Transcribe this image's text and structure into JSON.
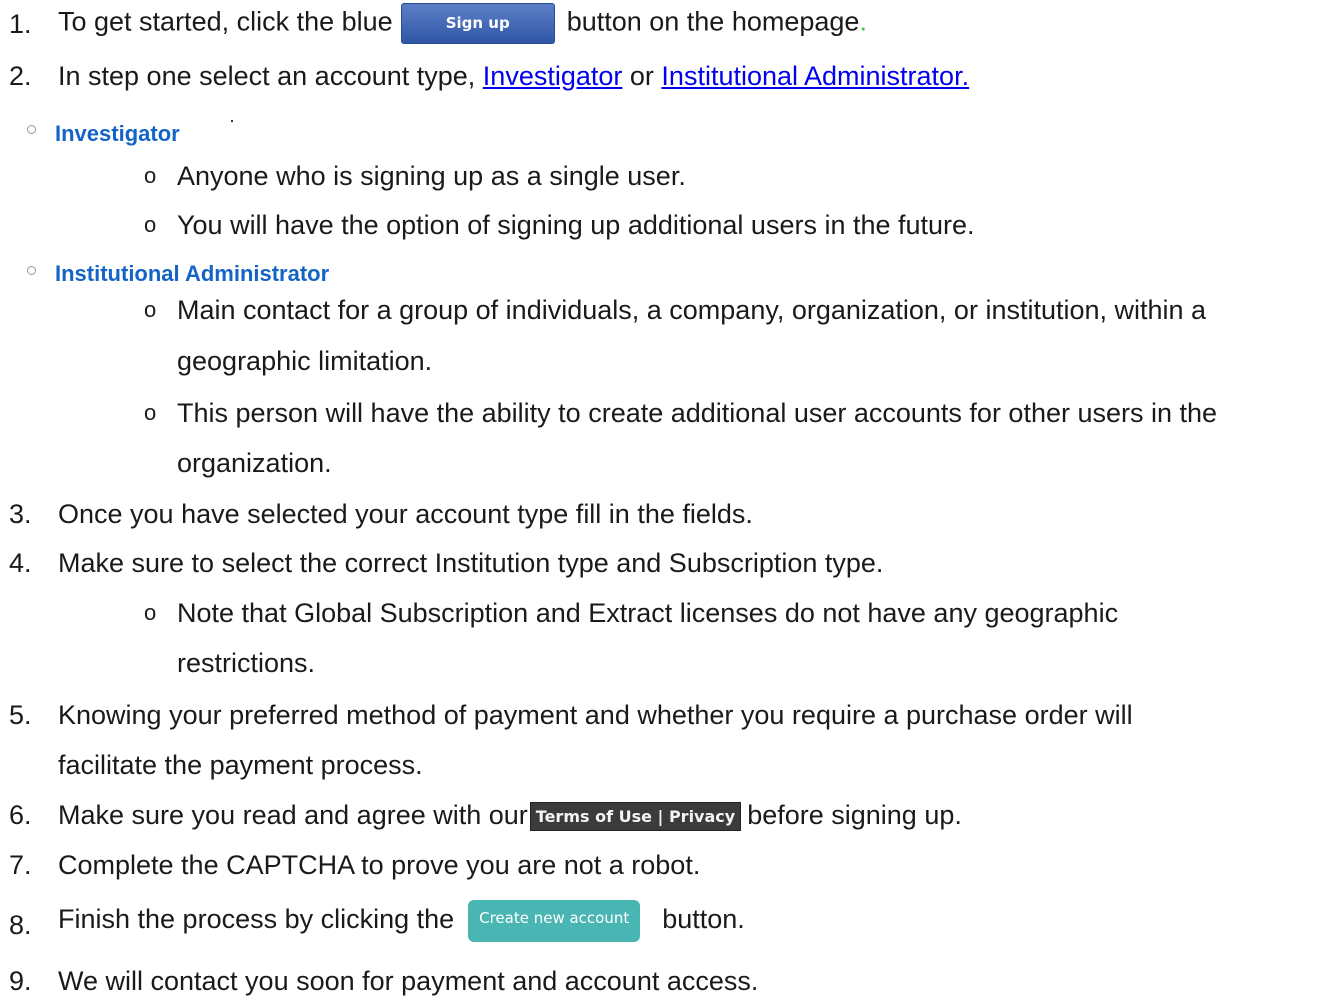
{
  "steps": {
    "s1": {
      "num": "1.",
      "before": "To get started, click the blue",
      "button": "Sign up",
      "after": "button on the homepage",
      "dot": "."
    },
    "s2": {
      "num": "2.",
      "before": "In step one select an account type,",
      "link1": "Investigator",
      "mid": "or",
      "link2": "Institutional Administrator."
    },
    "s3": {
      "num": "3.",
      "text": "Once you have selected your account type fill in the fields."
    },
    "s4": {
      "num": "4.",
      "text": "Make sure to select the correct Institution type and Subscription type."
    },
    "s5": {
      "num": "5.",
      "text_line1": "Knowing your preferred method of payment and whether you require a purchase order will",
      "text_line2": "facilitate the payment process."
    },
    "s6": {
      "num": "6.",
      "before": "Make sure you read and agree with our",
      "button": "Terms of Use | Privacy",
      "after": "before signing up."
    },
    "s7": {
      "num": "7.",
      "text": "Complete the CAPTCHA to prove you are not a robot."
    },
    "s8": {
      "num": "8.",
      "before": "Finish the process by clicking the",
      "button": "Create new account",
      "after": "button."
    },
    "s9": {
      "num": "9.",
      "text": "We will contact you soon for payment and account access."
    }
  },
  "investigator": {
    "label": "Investigator",
    "bullets": [
      "Anyone who is signing up as a single user.",
      "You will have the option of signing up additional users in the future."
    ]
  },
  "institutional": {
    "label": "Institutional Administrator",
    "bullets": [
      {
        "line1": "Main contact for a group of individuals, a company, organization, or institution, within a",
        "line2": "geographic limitation."
      },
      {
        "line1": "This person will have the ability to create additional user accounts for other users in the",
        "line2": "organization."
      }
    ]
  },
  "note": {
    "line1": "Note that Global Subscription and Extract licenses do not have any geographic",
    "line2": "restrictions."
  },
  "sub_bullet_glyph": "o",
  "colors": {
    "signup_button": "#2f56a6",
    "create_button": "#4ab6b4",
    "terms_button": "#3b3b3b",
    "section_label": "#1464c8",
    "link": "#0000ee"
  }
}
